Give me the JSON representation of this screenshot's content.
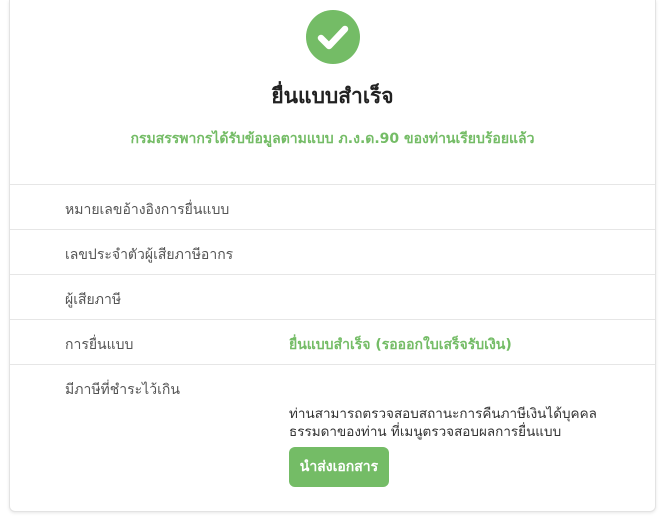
{
  "status": {
    "icon": "check-circle-icon",
    "accent_color": "#74bc66",
    "title": "ยื่นแบบสำเร็จ",
    "message": "กรมสรรพากรได้รับข้อมูลตามแบบ ภ.ง.ด.90 ของท่านเรียบร้อยแล้ว"
  },
  "details": {
    "reference_label": "หมายเลขอ้างอิงการยื่นแบบ",
    "reference_value": "",
    "taxpayer_id_label": "เลขประจำตัวผู้เสียภาษีอากร",
    "taxpayer_id_value": "",
    "taxpayer_label": "ผู้เสียภาษี",
    "taxpayer_value": "",
    "filing_label": "การยื่นแบบ",
    "filing_value": "ยื่นแบบสำเร็จ (รอออกใบเสร็จรับเงิน)",
    "overpaid_label": "มีภาษีที่ชำระไว้เกิน",
    "overpaid_note": "ท่านสามารถตรวจสอบสถานะการคืนภาษีเงินได้บุคคลธรรมดาของท่าน ที่เมนูตรวจสอบผลการยื่นแบบ",
    "submit_docs_button": "นำส่งเอกสาร"
  }
}
